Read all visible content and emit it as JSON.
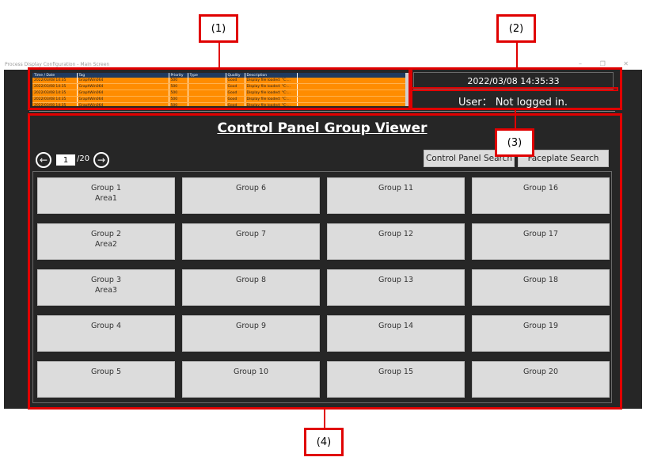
{
  "window": {
    "title": "Process Display Configuration - Main Screen",
    "controls": "–  ❐  ✕"
  },
  "alarm_table": {
    "columns": [
      "Time / Date",
      "Tag",
      "Priority",
      "Type",
      "Quality",
      "Description"
    ],
    "rows": [
      [
        "2022/03/08 14:35",
        "GraphWin064",
        "500",
        "",
        "Good",
        "Display file loaded: \"C:..."
      ],
      [
        "2022/03/08 14:35",
        "GraphWin064",
        "500",
        "",
        "Good",
        "Display file loaded: \"C:..."
      ],
      [
        "2022/03/08 14:35",
        "GraphWin064",
        "500",
        "",
        "Good",
        "Display file loaded: \"C:..."
      ],
      [
        "2022/03/08 14:35",
        "GraphWin064",
        "500",
        "",
        "Good",
        "Display file loaded: \"C:..."
      ],
      [
        "2022/03/08 14:35",
        "GraphWin064",
        "500",
        "",
        "Good",
        "Display file loaded: \"C:..."
      ]
    ]
  },
  "header": {
    "datetime": "2022/03/08 14:35:33",
    "user": "User： Not logged in."
  },
  "viewer": {
    "title": "Control Panel Group Viewer",
    "page_current": "1",
    "page_total": "/20",
    "prev_icon": "←",
    "next_icon": "→",
    "control_panel_search": "Control Panel Search",
    "faceplate_search": "Faceplate Search",
    "groups": [
      {
        "name": "Group 1",
        "area": "Area1"
      },
      {
        "name": "Group 2",
        "area": "Area2"
      },
      {
        "name": "Group 3",
        "area": "Area3"
      },
      {
        "name": "Group 4",
        "area": ""
      },
      {
        "name": "Group 5",
        "area": ""
      },
      {
        "name": "Group 6",
        "area": ""
      },
      {
        "name": "Group 7",
        "area": ""
      },
      {
        "name": "Group 8",
        "area": ""
      },
      {
        "name": "Group 9",
        "area": ""
      },
      {
        "name": "Group 10",
        "area": ""
      },
      {
        "name": "Group 11",
        "area": ""
      },
      {
        "name": "Group 12",
        "area": ""
      },
      {
        "name": "Group 13",
        "area": ""
      },
      {
        "name": "Group 14",
        "area": ""
      },
      {
        "name": "Group 15",
        "area": ""
      },
      {
        "name": "Group 16",
        "area": ""
      },
      {
        "name": "Group 17",
        "area": ""
      },
      {
        "name": "Group 18",
        "area": ""
      },
      {
        "name": "Group 19",
        "area": ""
      },
      {
        "name": "Group 20",
        "area": ""
      }
    ]
  },
  "annotations": {
    "label_1": "(1)",
    "label_2": "(2)",
    "label_3": "(3)",
    "label_4": "(4)"
  },
  "colors": {
    "annotation": "#e00000",
    "app_background": "#262626",
    "alarm_row": "#ff8c00",
    "button": "#dcdcdc"
  }
}
